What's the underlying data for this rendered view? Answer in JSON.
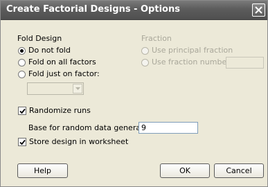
{
  "window": {
    "title": "Create Factorial Designs - Options"
  },
  "fold_design": {
    "heading": "Fold Design",
    "options": [
      {
        "label": "Do not fold",
        "selected": true
      },
      {
        "label": "Fold on all factors",
        "selected": false
      },
      {
        "label": "Fold just on factor:",
        "selected": false
      }
    ],
    "factor_select_value": ""
  },
  "fraction": {
    "heading": "Fraction",
    "options": [
      {
        "label": "Use principal fraction",
        "enabled": false
      },
      {
        "label": "Use fraction number:",
        "enabled": false
      }
    ],
    "fraction_number_value": ""
  },
  "randomize": {
    "label": "Randomize runs",
    "checked": true,
    "seed_label": "Base for random data generator:",
    "seed_value": "9"
  },
  "store": {
    "label": "Store design in worksheet",
    "checked": true
  },
  "buttons": {
    "help": "Help",
    "ok": "OK",
    "cancel": "Cancel"
  }
}
